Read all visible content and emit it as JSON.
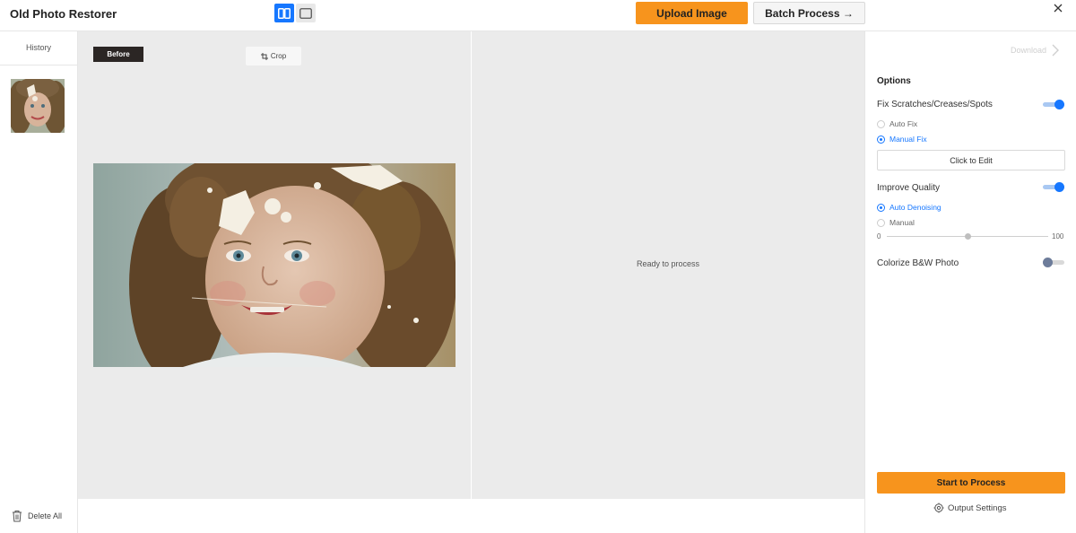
{
  "header": {
    "app_title": "Old Photo Restorer",
    "upload_label": "Upload Image",
    "batch_label": "Batch Process →",
    "view_modes": [
      "split-view-icon",
      "single-view-icon"
    ]
  },
  "history": {
    "title": "History",
    "delete_all_label": "Delete All"
  },
  "canvas": {
    "before_label": "Before",
    "crop_label": "Crop",
    "ready_text": "Ready to process"
  },
  "options": {
    "download_label": "Download",
    "heading": "Options",
    "fix_scratches": {
      "label": "Fix Scratches/Creases/Spots",
      "enabled": true,
      "modes": [
        {
          "label": "Auto Fix",
          "selected": false
        },
        {
          "label": "Manual Fix",
          "selected": true
        }
      ],
      "edit_label": "Click to Edit"
    },
    "improve_quality": {
      "label": "Improve Quality",
      "enabled": true,
      "modes": [
        {
          "label": "Auto Denoising",
          "selected": true
        },
        {
          "label": "Manual",
          "selected": false
        }
      ],
      "slider_min": "0",
      "slider_max": "100",
      "slider_value": 50
    },
    "colorize": {
      "label": "Colorize B&W Photo",
      "enabled": false
    },
    "start_label": "Start to Process",
    "output_settings_label": "Output Settings"
  },
  "colors": {
    "accent_orange": "#f7941d",
    "accent_blue": "#1677ff"
  }
}
